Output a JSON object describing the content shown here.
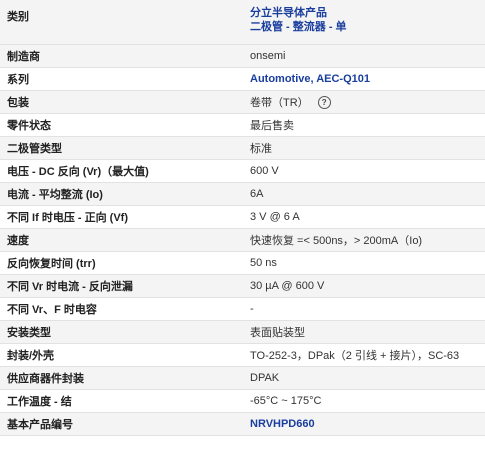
{
  "header": {
    "label": "类别",
    "value_line1": "分立半导体产品",
    "value_line2": "二极管 - 整流器 - 单"
  },
  "rows": [
    {
      "label": "制造商",
      "value": "onsemi"
    },
    {
      "label": "系列",
      "value": "Automotive, AEC-Q101"
    },
    {
      "label": "包装",
      "value": "卷带（TR）",
      "help_icon": "?"
    },
    {
      "label": "零件状态",
      "value": "最后售卖"
    },
    {
      "label": "二极管类型",
      "value": "标准"
    },
    {
      "label": "电压 - DC 反向 (Vr)（最大值)",
      "value": "600 V"
    },
    {
      "label": "电流 - 平均整流 (Io)",
      "value": "6A"
    },
    {
      "label": "不同 If 时电压 - 正向 (Vf)",
      "value": "3 V @ 6 A"
    },
    {
      "label": "速度",
      "value": "快速恢复 =< 500ns，> 200mA（Io)"
    },
    {
      "label": "反向恢复时间 (trr)",
      "value": "50 ns"
    },
    {
      "label": "不同 Vr 时电流 - 反向泄漏",
      "value": "30 µA @ 600 V"
    },
    {
      "label": "不同 Vr、F 时电容",
      "value": "-"
    },
    {
      "label": "安装类型",
      "value": "表面贴装型"
    },
    {
      "label": "封装/外壳",
      "value": "TO-252-3，DPak（2 引线 + 接片），SC-63"
    },
    {
      "label": "供应商器件封装",
      "value": "DPAK"
    },
    {
      "label": "工作温度 - 结",
      "value": "-65°C ~ 175°C"
    },
    {
      "label": "基本产品编号",
      "value": "NRVHPD660"
    }
  ],
  "colors": {
    "link": "#1a3e9e",
    "stripe": "#f4f4f4",
    "border": "#e2e2e2"
  },
  "icons": {
    "help": "question-circle-icon"
  }
}
